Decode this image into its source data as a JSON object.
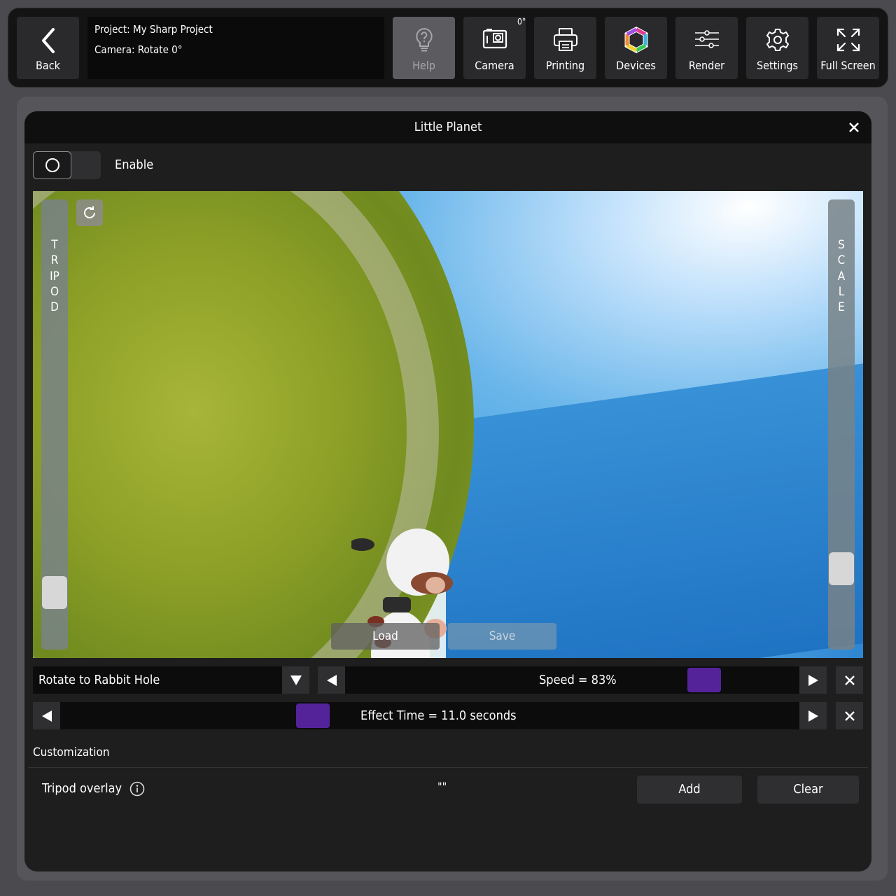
{
  "toolbar": {
    "back_label": "Back",
    "project_line": "Project: My Sharp Project",
    "camera_line": "Camera: Rotate 0°",
    "camera_badge": "0°",
    "help_label": "Help",
    "camera_label": "Camera",
    "printing_label": "Printing",
    "devices_label": "Devices",
    "render_label": "Render",
    "settings_label": "Settings",
    "fullscreen_label": "Full Screen"
  },
  "modal": {
    "title": "Little Planet",
    "enable_label": "Enable",
    "enabled": false
  },
  "preview": {
    "tripod_label": "TRIPOD",
    "scale_label": "SCALE",
    "load_label": "Load",
    "save_label": "Save"
  },
  "controls": {
    "effect_selected": "Rotate to Rabbit Hole",
    "speed_label": "Speed = 83%",
    "speed_value": 83,
    "effect_time_label": "Effect Time =  11.0 seconds",
    "effect_time_value": 11.0
  },
  "customization": {
    "title": "Customization",
    "tripod_overlay_label": "Tripod overlay",
    "tripod_overlay_value": "\"\"",
    "add_label": "Add",
    "clear_label": "Clear"
  },
  "colors": {
    "accent": "#54239a",
    "modal_bg": "#1e1e1f",
    "toolbar_bg": "#141414"
  }
}
